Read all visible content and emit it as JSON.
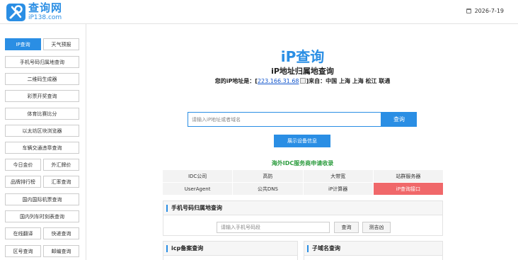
{
  "header": {
    "site_name": "查询网",
    "site_domain": "iP138.com",
    "date": "2026-7-19"
  },
  "sidebar": {
    "rows": [
      [
        {
          "label": "IP查询",
          "active": true
        },
        {
          "label": "天气预报"
        }
      ],
      [
        {
          "label": "手机号码归属地查询"
        }
      ],
      [
        {
          "label": "二维码生成器"
        }
      ],
      [
        {
          "label": "彩票开奖查询"
        }
      ],
      [
        {
          "label": "体育比赛比分"
        }
      ],
      [
        {
          "label": "以太坊区块浏览器"
        }
      ],
      [
        {
          "label": "车辆交通违章查询"
        }
      ],
      [
        {
          "label": "今日金价"
        },
        {
          "label": "外汇牌价"
        }
      ],
      [
        {
          "label": "品牌排行榜"
        },
        {
          "label": "汇率查询"
        }
      ],
      [
        {
          "label": "国内国际机票查询"
        }
      ],
      [
        {
          "label": "国内列车时刻表查询"
        }
      ],
      [
        {
          "label": "在线翻译"
        },
        {
          "label": "快递查询"
        }
      ],
      [
        {
          "label": "区号查询"
        },
        {
          "label": "邮编查询"
        }
      ]
    ]
  },
  "main": {
    "brand": "iP查询",
    "subtitle": "iP地址归属地查询",
    "ip_prefix": "您的iP地址是：[",
    "ip_address": "223.166.31.68",
    "ip_suffix": "]来自：中国 上海 上海 松江 联通",
    "search_placeholder": "请输入iP地址或者域名",
    "search_button": "查询",
    "device_button": "展示设备信息",
    "ad_title": "海外IDC服务商申请收录",
    "tools": [
      [
        "IDC公司",
        "高防",
        "大带宽",
        "站群服务器"
      ],
      [
        "UserAgent",
        "公共DNS",
        "iP计算器",
        "iP查询接口"
      ]
    ],
    "mobile_panel": {
      "title": "手机号码归属地查询",
      "placeholder": "请输入手机号码段",
      "query_button": "查询",
      "fortune_button": "测吉凶"
    },
    "icp_panel_title": "icp备案查询",
    "subdomain_panel_title": "子域名查询"
  },
  "colors": {
    "accent": "#2a8ee4",
    "hot": "#f0686a",
    "ad_green": "#2a9b3c"
  }
}
